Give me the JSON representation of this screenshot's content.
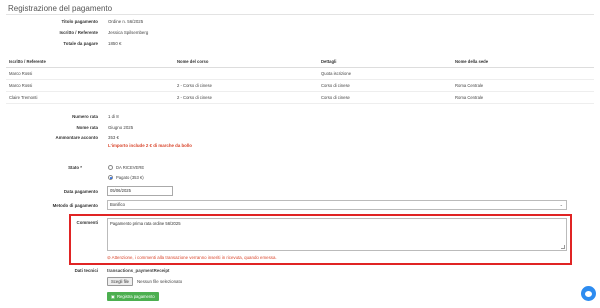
{
  "page": {
    "title": "Registrazione del pagamento"
  },
  "summary": {
    "titolo_label": "Titolo pagamento",
    "titolo_value": "Ordine n. 56/2025",
    "iscritto_label": "Iscritto / Referente",
    "iscritto_value": "Jessica Spilsemberg",
    "totale_label": "Totale da pagare",
    "totale_value": "1850 €"
  },
  "table": {
    "headers": [
      "Iscritto / Referente",
      "Nome del corso",
      "Dettagli",
      "Nome della sede"
    ],
    "rows": [
      [
        "Marco Rossi",
        "",
        "Quota iscrizione",
        ""
      ],
      [
        "Marco Rossi",
        "2 - Corso di cinese",
        "Corso di cinese",
        "Roma Centrale"
      ],
      [
        "Claire Tremonti",
        "2 - Corso di cinese",
        "Corso di cinese",
        "Roma Centrale"
      ]
    ]
  },
  "rata": {
    "numero_label": "Numero rata",
    "numero_value": "1 di 8",
    "nome_label": "Nome rata",
    "nome_value": "Giugno 2025",
    "acconto_label": "Ammontare acconto",
    "acconto_value": "353 €",
    "bollo_note": "L'importo include 2 € di marche da bollo"
  },
  "form": {
    "stato_label": "Stato *",
    "stato_options": [
      "DA RICEVERE",
      "Pagato (353 €)"
    ],
    "data_label": "Data pagamento",
    "data_value": "05/06/2025",
    "metodo_label": "Metodo di pagamento",
    "metodo_value": "Bonifico",
    "commenti_label": "Commenti",
    "commenti_value": "Pagamento prima rata ordine 56/2025",
    "commenti_warning": "Attenzione, i commenti alla transazione verranno inseriti in ricevuta, quando emessa.",
    "dati_label": "Dati tecnici",
    "dati_value": "transactions_paymentReceipt",
    "file_button": "Scegli file",
    "file_status": "Nessun file selezionato",
    "submit_button": "Registra pagamento"
  }
}
